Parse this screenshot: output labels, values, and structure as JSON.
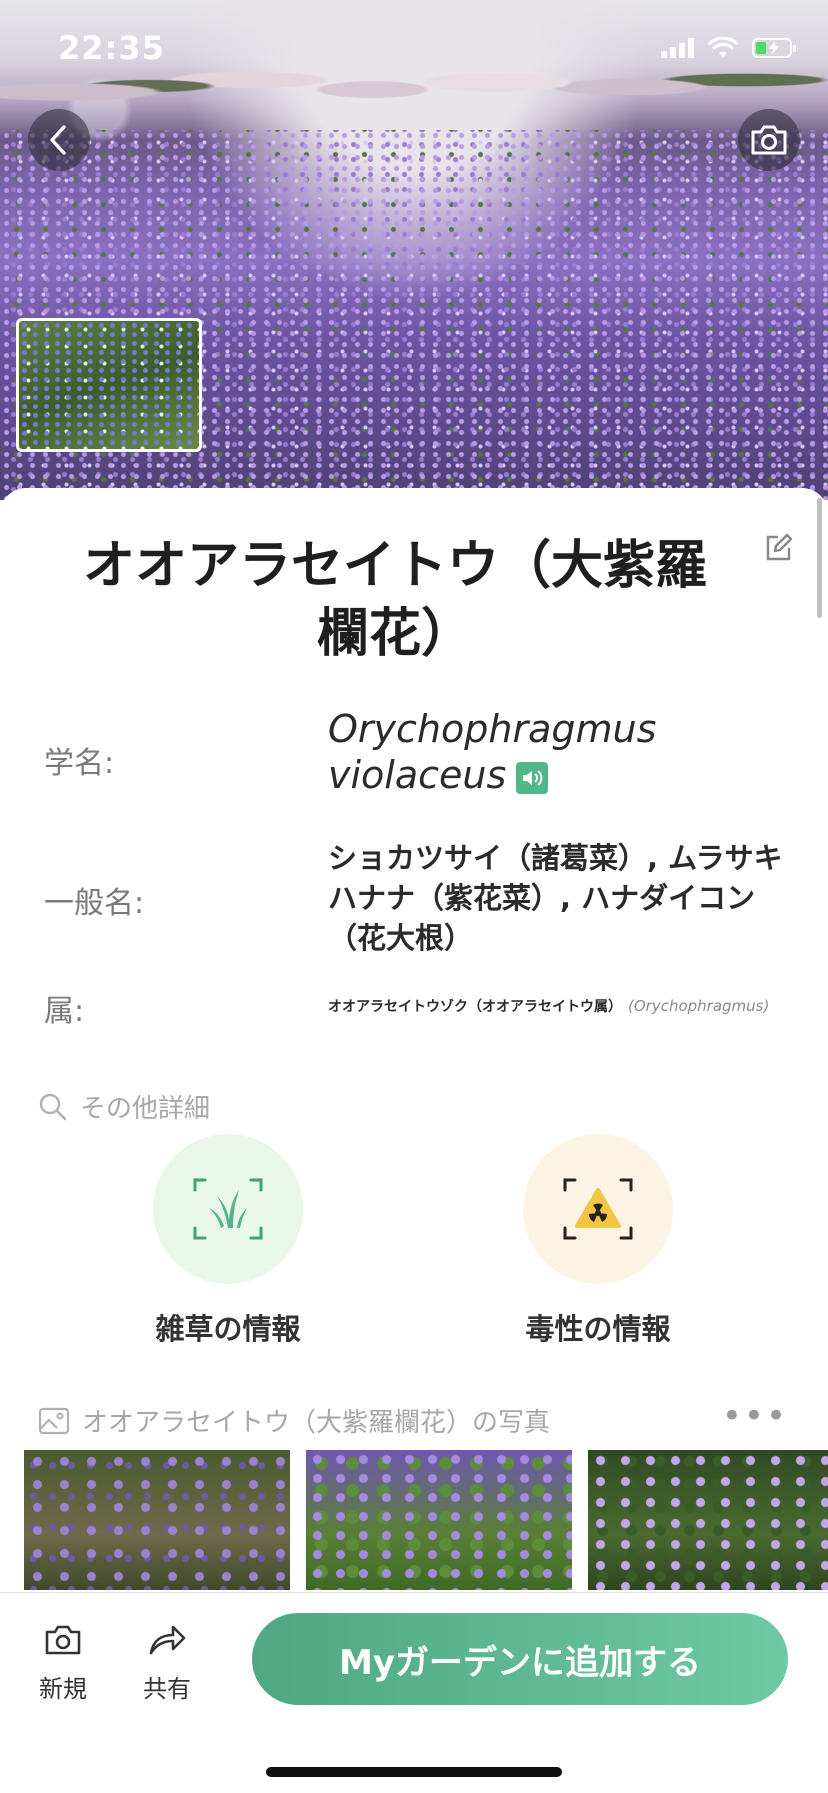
{
  "status_bar": {
    "time": "22:35"
  },
  "plant": {
    "title": "オオアラセイトウ（大紫羅欄花）",
    "scientific_name_label": "学名:",
    "scientific_name": "Orychophragmus violaceus",
    "common_name_label": "一般名:",
    "common_names": "ショカツサイ（諸葛菜）, ムラサキハナナ（紫花菜）, ハナダイコン（花大根）",
    "genus_label": "属:",
    "genus": "オオアラセイトウゾク（オオアラセイトウ属）",
    "genus_scientific": "(Orychophragmus)"
  },
  "details": {
    "header": "その他詳細",
    "weed_info": "雑草の情報",
    "toxicity_info": "毒性の情報"
  },
  "photos": {
    "header": "オオアラセイトウ（大紫羅欄花）の写真",
    "more": "•••"
  },
  "bottom_bar": {
    "new_label": "新規",
    "share_label": "共有",
    "add_button": "Myガーデンに追加する"
  },
  "colors": {
    "accent": "#52b788",
    "weed_circle": "#e9f6ea",
    "toxic_circle": "#fdf3e4"
  }
}
